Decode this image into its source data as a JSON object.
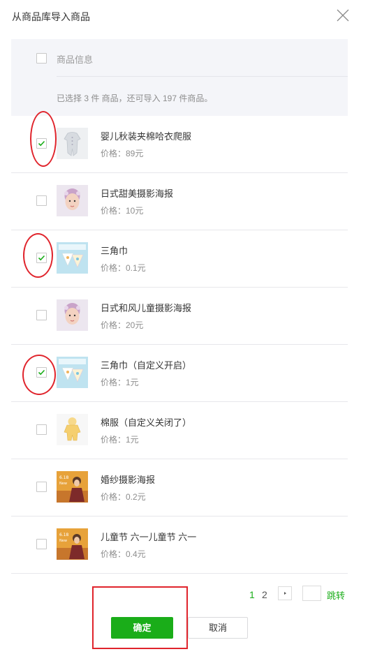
{
  "dialog": {
    "title": "从商品库导入商品"
  },
  "header": {
    "column_label": "商品信息",
    "summary": "已选择 3 件 商品，还可导入 197 件商品。"
  },
  "products": [
    {
      "name": "婴儿秋装夹棉哈衣爬服",
      "price": "价格：89元",
      "checked": true,
      "thumb": "baby-romper"
    },
    {
      "name": "日式甜美摄影海报",
      "price": "价格：10元",
      "checked": false,
      "thumb": "child-portrait"
    },
    {
      "name": "三角巾",
      "price": "价格：0.1元",
      "checked": true,
      "thumb": "bib-pack"
    },
    {
      "name": "日式和风儿童摄影海报",
      "price": "价格：20元",
      "checked": false,
      "thumb": "child-portrait"
    },
    {
      "name": "三角巾（自定义开启）",
      "price": "价格：1元",
      "checked": true,
      "thumb": "bib-pack"
    },
    {
      "name": "棉服（自定义关闭了）",
      "price": "价格：1元",
      "checked": false,
      "thumb": "yellow-snowsuit"
    },
    {
      "name": "婚纱摄影海报",
      "price": "价格：0.2元",
      "checked": false,
      "thumb": "poster-girl"
    },
    {
      "name": "儿童节 六一儿童节 六一",
      "price": "价格：0.4元",
      "checked": false,
      "thumb": "poster-girl"
    }
  ],
  "pagination": {
    "pages": [
      "1",
      "2"
    ],
    "current": "1",
    "jump_label": "跳转",
    "jump_value": ""
  },
  "footer": {
    "confirm_label": "确定",
    "cancel_label": "取消"
  },
  "colors": {
    "accent": "#1aad19",
    "annotation": "#e0242c"
  }
}
